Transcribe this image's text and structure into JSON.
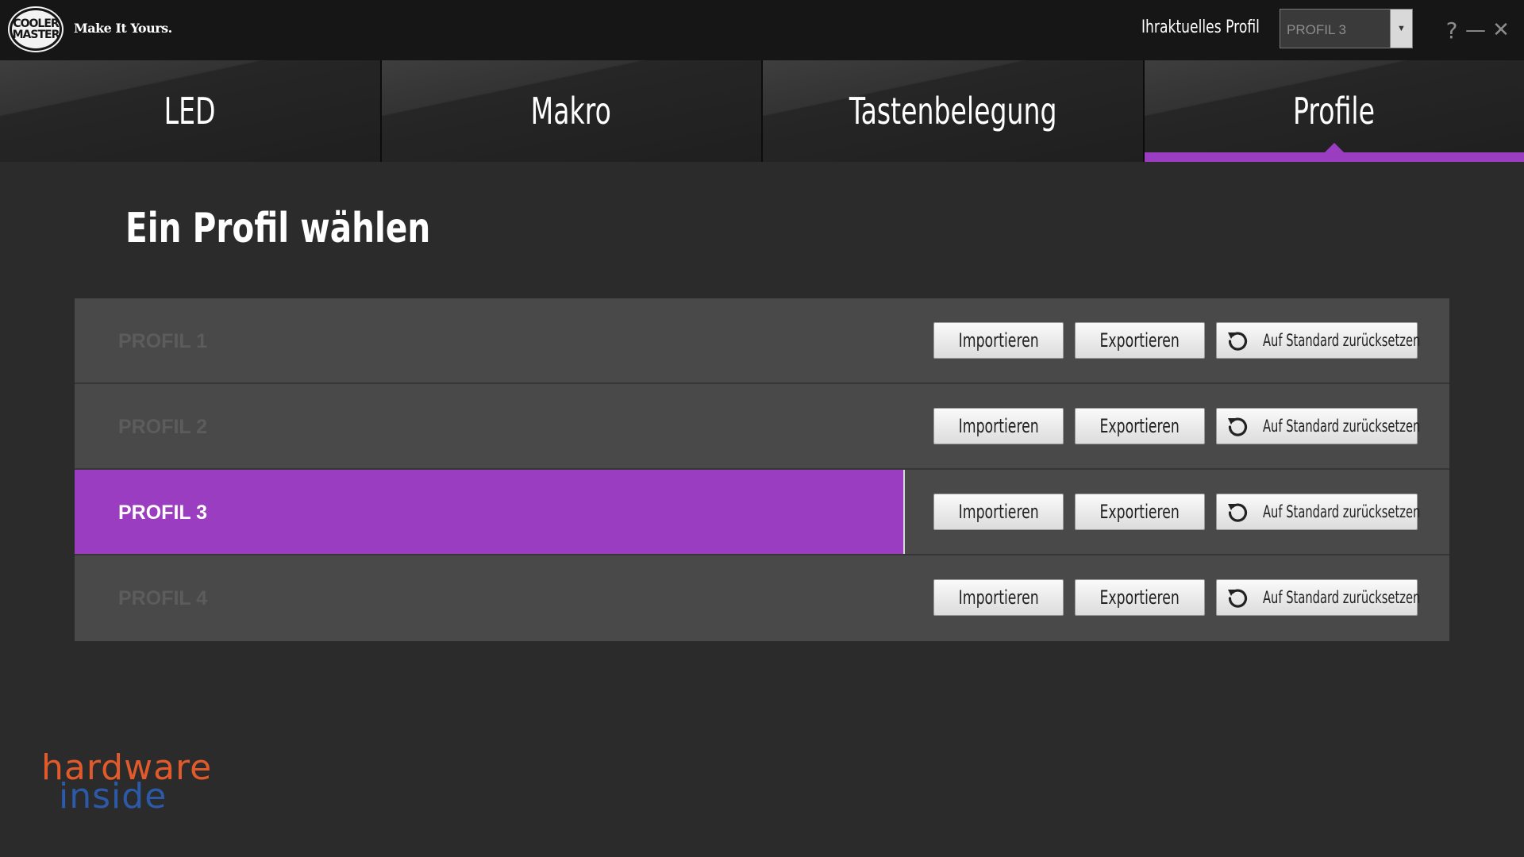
{
  "header": {
    "logo_line1": "COOLER",
    "logo_line2": "MASTER",
    "tagline": "Make It Yours.",
    "current_profile_label": "Ihraktuelles Profil",
    "current_profile_value": "PROFIL 3",
    "help_glyph": "?",
    "minimize_glyph": "—",
    "close_glyph": "✕"
  },
  "tabs": [
    {
      "label": "LED",
      "active": false
    },
    {
      "label": "Makro",
      "active": false
    },
    {
      "label": "Tastenbelegung",
      "active": false
    },
    {
      "label": "Profile",
      "active": true
    }
  ],
  "main": {
    "title": "Ein Profil wählen",
    "profiles": [
      {
        "name": "PROFIL 1",
        "active": false,
        "import_label": "Importieren",
        "export_label": "Exportieren",
        "reset_label": "Auf Standard zurücksetzen"
      },
      {
        "name": "PROFIL 2",
        "active": false,
        "import_label": "Importieren",
        "export_label": "Exportieren",
        "reset_label": "Auf Standard zurücksetzen"
      },
      {
        "name": "PROFIL 3",
        "active": true,
        "import_label": "Importieren",
        "export_label": "Exportieren",
        "reset_label": "Auf Standard zurücksetzen"
      },
      {
        "name": "PROFIL 4",
        "active": false,
        "import_label": "Importieren",
        "export_label": "Exportieren",
        "reset_label": "Auf Standard zurücksetzen"
      }
    ]
  },
  "watermark": {
    "line1": "hardware",
    "line2": "inside"
  },
  "colors": {
    "accent": "#9a3dc0",
    "background": "#2b2b2b",
    "row": "#494949",
    "watermark_orange": "#e05a2c",
    "watermark_blue": "#2c5aa8"
  },
  "icons": {
    "reset": "reset-arrow-icon",
    "dropdown": "caret-down-icon"
  }
}
